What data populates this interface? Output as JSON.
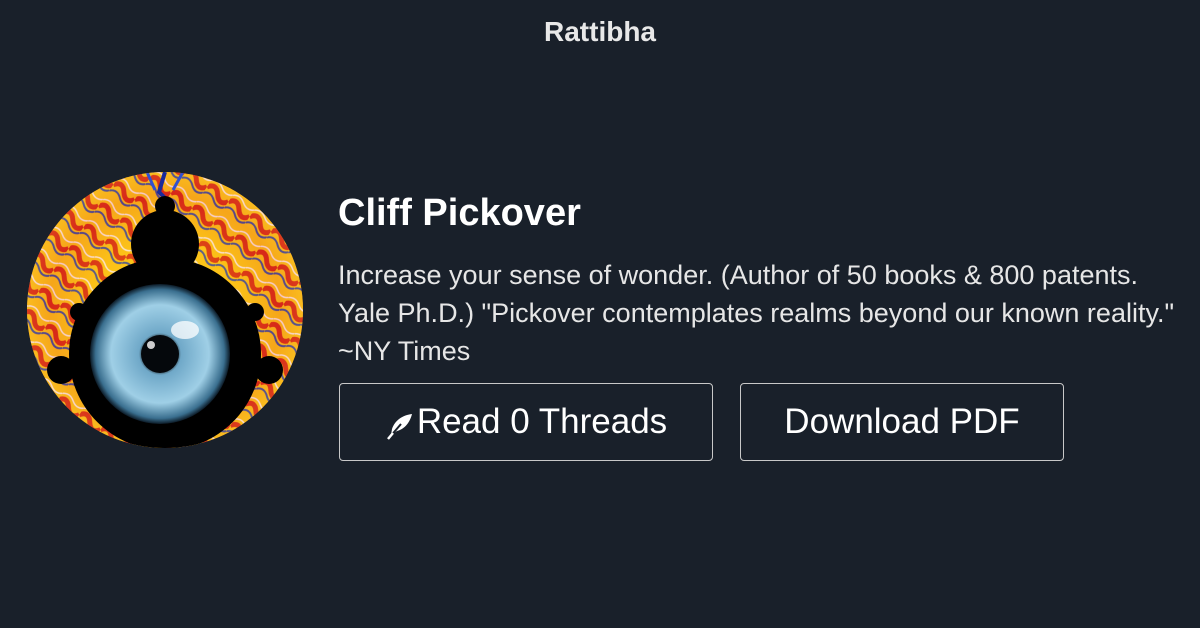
{
  "site": {
    "brand": "Rattibha"
  },
  "profile": {
    "name": "Cliff Pickover",
    "bio": "Increase your sense of wonder. (Author of 50 books & 800 patents. Yale Ph.D.) \"Pickover contemplates realms beyond our known reality.\" ~NY Times",
    "avatar_icon": "fractal-eye-avatar"
  },
  "actions": {
    "read_label": "Read 0 Threads",
    "read_icon": "feather-icon",
    "pdf_label": "Download PDF"
  },
  "colors": {
    "background": "#19202a",
    "text": "#ffffff",
    "button_border": "#c8c8c8"
  }
}
